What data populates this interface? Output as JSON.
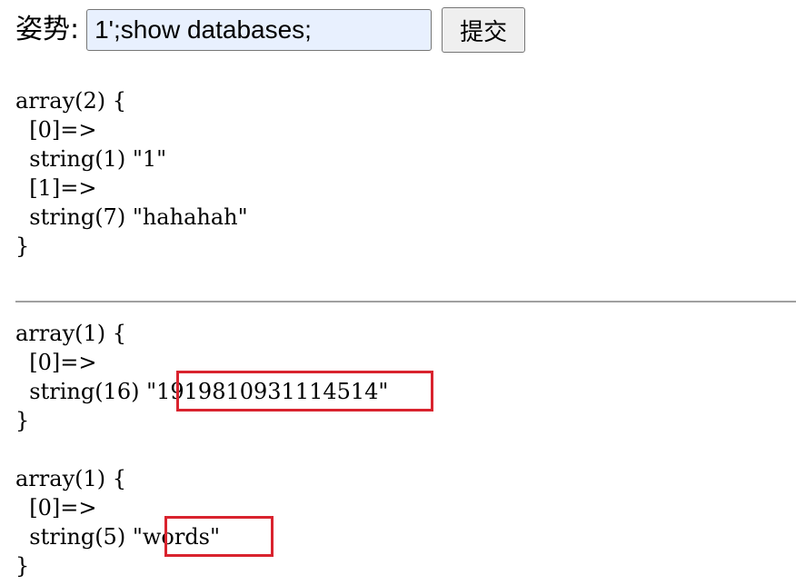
{
  "form": {
    "label": "姿势:",
    "input_value": "1';show databases;",
    "submit_label": "提交"
  },
  "results": [
    {
      "lines": [
        "array(2) {",
        "  [0]=>",
        "  string(1) \"1\"",
        "  [1]=>",
        "  string(7) \"hahahah\"",
        "}"
      ]
    },
    {
      "lines": [
        "array(1) {",
        "  [0]=>",
        "  string(16) \"1919810931114514\"",
        "}"
      ]
    },
    {
      "lines": [
        "array(1) {",
        "  [0]=>",
        "  string(5) \"words\"",
        "}"
      ]
    }
  ],
  "annotation": {
    "color": "#d9232e",
    "highlighted_values": [
      "\"1919810931114514\"",
      "\"words\""
    ]
  }
}
